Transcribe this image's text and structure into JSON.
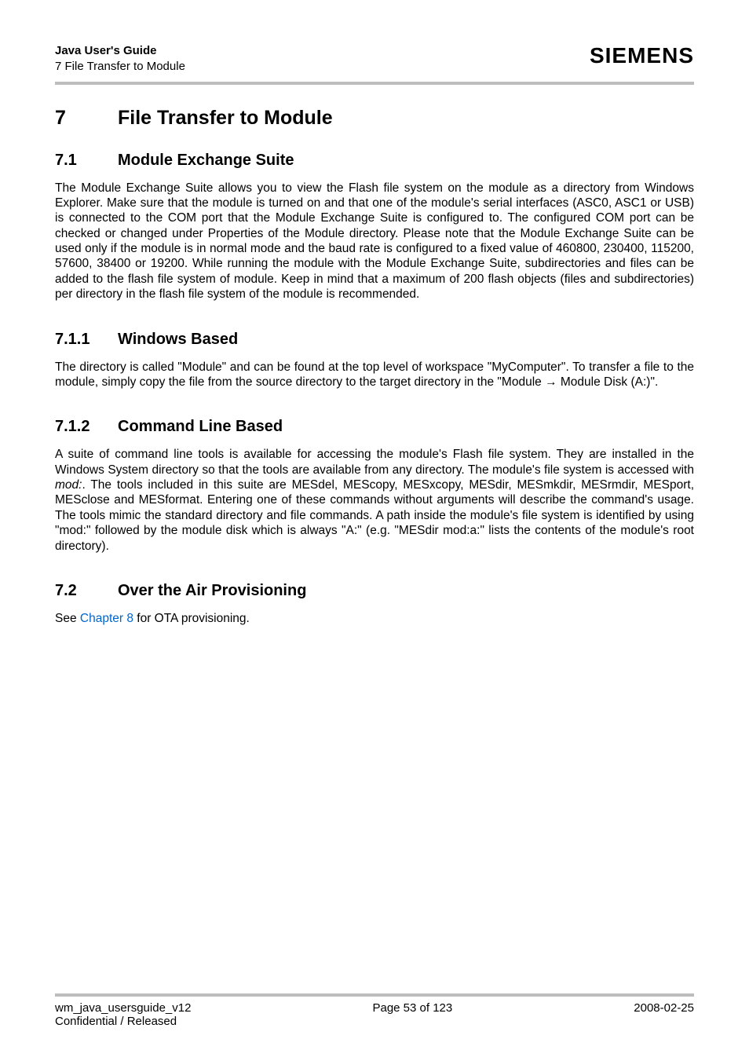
{
  "header": {
    "title": "Java User's Guide",
    "subtitle": "7 File Transfer to Module",
    "brand": "SIEMENS"
  },
  "chapter": {
    "num": "7",
    "title": "File Transfer to Module"
  },
  "sections": {
    "s71": {
      "num": "7.1",
      "title": "Module Exchange Suite",
      "para": "The Module Exchange Suite allows you to view the Flash file system on the module as a directory from Windows Explorer. Make sure that the module is turned on and that one of the module's serial interfaces (ASC0, ASC1 or USB) is connected to the COM port that the Module Exchange Suite is configured to. The configured COM port can be checked or changed under Properties of the Module directory.  Please note that the Module Exchange Suite can be used only if the module is in normal mode and the baud rate is configured to a fixed value of 460800, 230400, 115200, 57600, 38400 or 19200.  While running the module with the Module Exchange Suite, subdirectories and files can be added to the flash file system of module. Keep in mind that a maximum of 200 flash objects (files and subdirectories) per directory in the flash file system of the module is recommended."
    },
    "s711": {
      "num": "7.1.1",
      "title": "Windows Based",
      "para_pre": "The directory is called \"Module\" and can be found at the top level of workspace \"MyComputer\". To transfer a file to the module, simply copy the file from the source directory to the target directory in the \"Module ",
      "arrow": "→",
      "para_post": " Module Disk (A:)\"."
    },
    "s712": {
      "num": "7.1.2",
      "title": "Command Line Based",
      "para_pre": "A suite of command line tools is available for accessing the module's Flash file system. They are installed in the Windows System directory so that the tools are available from any directory. The module's file system is accessed with ",
      "mod": "mod:",
      "para_post": ". The tools included in this suite are MESdel, MEScopy, MESxcopy, MESdir, MESmkdir, MESrmdir, MESport, MESclose and MESformat. Entering one of these commands without arguments will describe the command's usage. The tools mimic the standard directory and file commands. A path inside the module's file system is identified by using \"mod:\" followed by the module disk which is always \"A:\" (e.g. \"MESdir mod:a:\" lists the contents of the module's root directory)."
    },
    "s72": {
      "num": "7.2",
      "title": "Over the Air Provisioning",
      "para_pre": "See ",
      "link": "Chapter 8",
      "para_post": " for OTA provisioning."
    }
  },
  "footer": {
    "left": "wm_java_usersguide_v12",
    "center": "Page 53 of 123",
    "right": "2008-02-25",
    "left2": "Confidential / Released"
  }
}
